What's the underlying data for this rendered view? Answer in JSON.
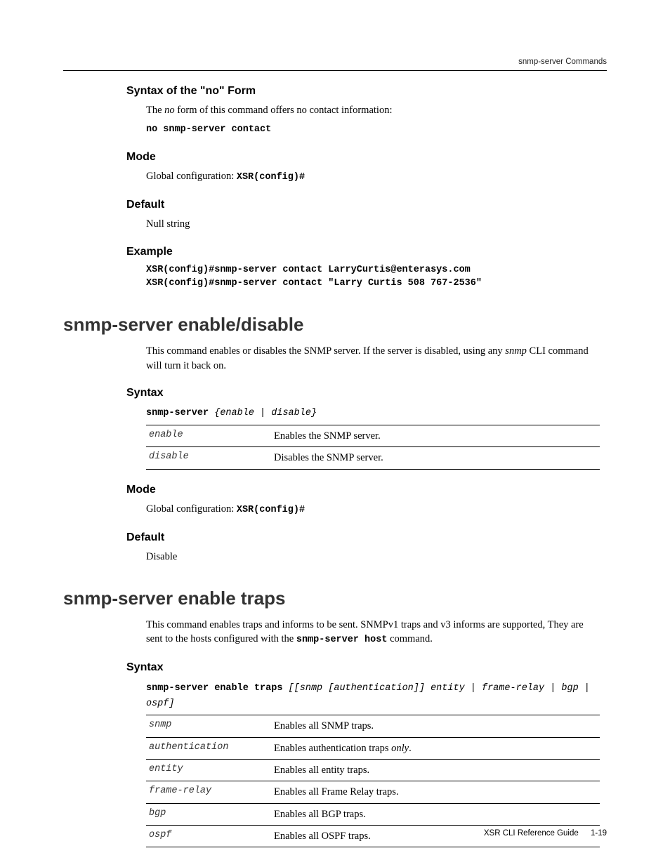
{
  "running_head": "snmp-server Commands",
  "sec_no_form": {
    "heading": "Syntax of the \"no\" Form",
    "body_pre": "The ",
    "body_ital": "no",
    "body_post": " form of this command offers no contact information:",
    "code": "no snmp-server contact"
  },
  "mode1": {
    "heading": "Mode",
    "text": "Global configuration: ",
    "code": "XSR(config)#"
  },
  "default1": {
    "heading": "Default",
    "text": "Null string"
  },
  "example1": {
    "heading": "Example",
    "line1": "XSR(config)#snmp-server contact LarryCurtis@enterasys.com",
    "line2": "XSR(config)#snmp-server contact \"Larry Curtis 508 767-2536\""
  },
  "topic1": {
    "title": "snmp-server enable/disable",
    "desc_pre": "This command enables or disables the SNMP server. If the server is disabled, using any ",
    "desc_ital": "snmp",
    "desc_post": " CLI command will turn it back on."
  },
  "syntax1": {
    "heading": "Syntax",
    "cmd_bold": "snmp-server",
    "cmd_rest": " {enable | disable}",
    "rows": [
      {
        "k": "enable",
        "v": "Enables the SNMP server."
      },
      {
        "k": "disable",
        "v": "Disables the SNMP server."
      }
    ]
  },
  "mode2": {
    "heading": "Mode",
    "text": "Global configuration: ",
    "code": "XSR(config)#"
  },
  "default2": {
    "heading": "Default",
    "text": "Disable"
  },
  "topic2": {
    "title": "snmp-server enable traps",
    "desc_pre": "This command enables traps and informs to be sent. SNMPv1 traps and v3 informs are supported, They are sent to the hosts configured with the ",
    "desc_code": "snmp-server host",
    "desc_post": " command."
  },
  "syntax2": {
    "heading": "Syntax",
    "cmd_bold": "snmp-server enable traps",
    "cmd_rest": " [[snmp [authentication]] entity | frame-relay | bgp | ospf]",
    "rows": [
      {
        "k": "snmp",
        "v": "Enables all SNMP traps."
      },
      {
        "k": "authentication",
        "v_pre": "Enables authentication traps ",
        "v_ital": "only",
        "v_post": "."
      },
      {
        "k": "entity",
        "v": "Enables all entity traps."
      },
      {
        "k": "frame-relay",
        "v": "Enables all Frame Relay traps."
      },
      {
        "k": "bgp",
        "v": "Enables all BGP traps."
      },
      {
        "k": "ospf",
        "v": "Enables all OSPF traps."
      }
    ]
  },
  "footer": {
    "book": "XSR CLI Reference Guide",
    "page": "1-19"
  }
}
